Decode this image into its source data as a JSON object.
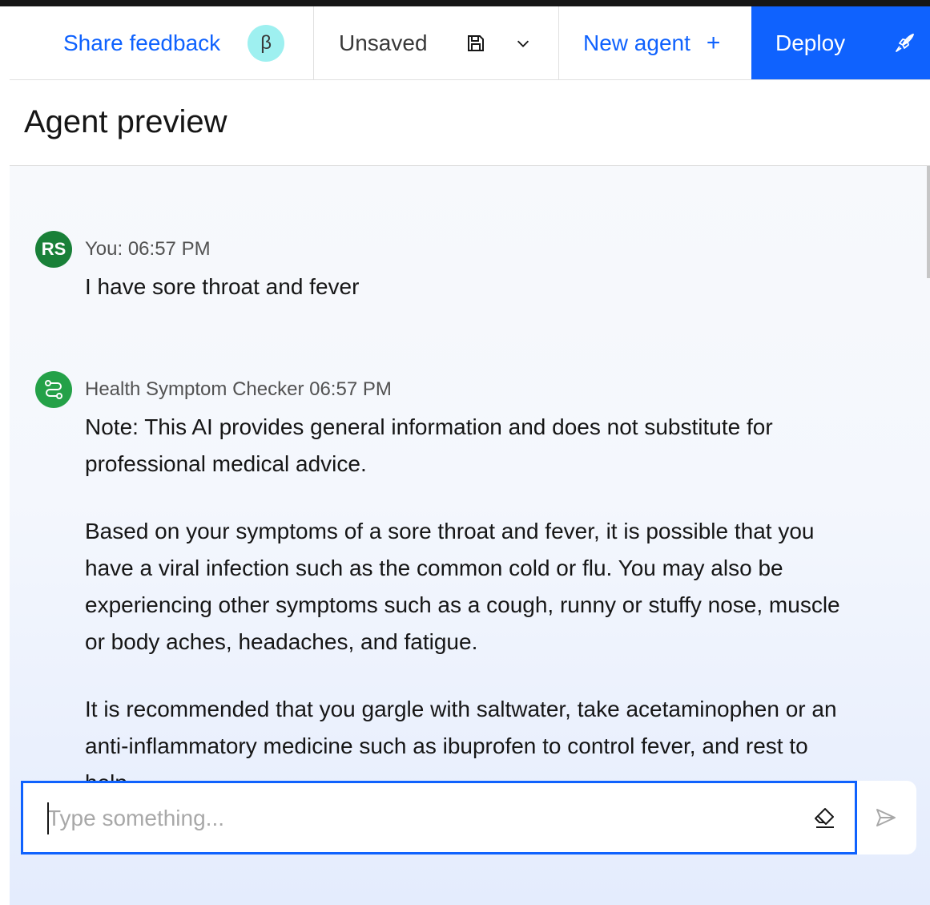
{
  "toolbar": {
    "share_feedback": "Share feedback",
    "beta_badge": "β",
    "save_status": "Unsaved",
    "new_agent": "New agent",
    "deploy": "Deploy"
  },
  "icons": {
    "save": "save-icon",
    "dropdown": "chevron-down-icon",
    "add": "plus-icon",
    "deploy": "rocket-icon",
    "clear": "eraser-icon",
    "send": "send-icon"
  },
  "panel": {
    "title": "Agent preview"
  },
  "messages": [
    {
      "avatar": "RS",
      "meta": "You: 06:57 PM",
      "paragraphs": [
        "I have sore throat and fever"
      ]
    },
    {
      "avatar": "",
      "meta": "Health Symptom Checker 06:57 PM",
      "paragraphs": [
        "Note: This AI provides general information and does not substitute for professional medical advice.",
        "Based on your symptoms of a sore throat and fever, it is possible that you have a viral infection such as the common cold or flu. You may also be experiencing other symptoms such as a cough, runny or stuffy nose, muscle or body aches, headaches, and fatigue.",
        "It is recommended that you gargle with saltwater, take acetaminophen or an anti-inflammatory medicine such as ibuprofen to control fever, and rest to help"
      ]
    }
  ],
  "composer": {
    "placeholder": "Type something..."
  },
  "colors": {
    "accent": "#0f62fe",
    "user_avatar": "#198038",
    "bot_avatar": "#24a148",
    "beta_badge": "#9ef0f0"
  }
}
